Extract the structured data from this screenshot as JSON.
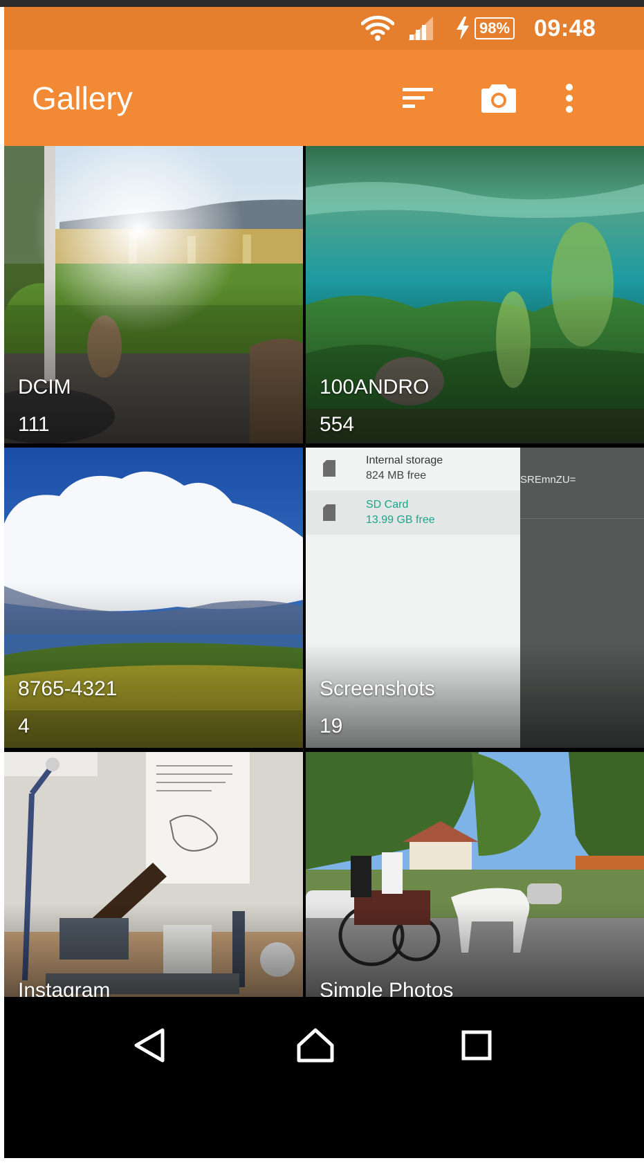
{
  "status_bar": {
    "battery": "98%",
    "time": "09:48",
    "icons": [
      "wifi-icon",
      "signal-icon",
      "charging-icon",
      "battery-icon"
    ]
  },
  "app_bar": {
    "title": "Gallery",
    "actions": [
      "sort-icon",
      "camera-icon",
      "overflow-menu-icon"
    ]
  },
  "albums": [
    {
      "name": "DCIM",
      "count": "111"
    },
    {
      "name": "100ANDRO",
      "count": "554"
    },
    {
      "name": "8765-4321",
      "count": "4"
    },
    {
      "name": "Screenshots",
      "count": "19"
    },
    {
      "name": "Instagram",
      "count": ""
    },
    {
      "name": "Simple Photos",
      "count": ""
    }
  ],
  "screenshot_thumbnail": {
    "internal_storage_label": "Internal storage",
    "internal_storage_free": "824 MB free",
    "sd_card_label": "SD Card",
    "sd_card_free": "13.99 GB free",
    "side_text": "SREmnZU="
  },
  "nav_bar": {
    "buttons": [
      "back-icon",
      "home-icon",
      "recents-icon"
    ]
  },
  "colors": {
    "status_bar": "#e57f2d",
    "app_bar": "#f28a35",
    "nav_bar": "#000000",
    "sd_card_accent": "#1ba48a"
  }
}
